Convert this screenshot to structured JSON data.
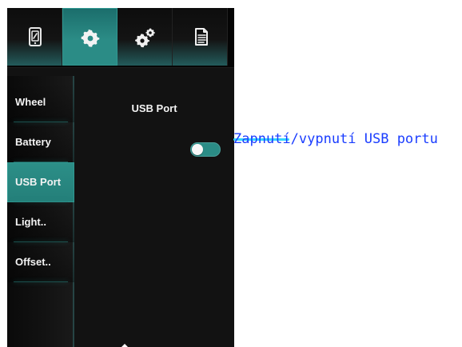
{
  "top_tabs": [
    {
      "name": "phone",
      "icon": "phone-icon",
      "active": false
    },
    {
      "name": "settings",
      "icon": "gear-icon",
      "active": true
    },
    {
      "name": "advanced",
      "icon": "gears-icon",
      "active": false
    },
    {
      "name": "log",
      "icon": "document-icon",
      "active": false
    }
  ],
  "sidebar": {
    "items": [
      {
        "label": "Wheel",
        "active": false
      },
      {
        "label": "Battery",
        "active": false
      },
      {
        "label": "USB Port",
        "active": true
      },
      {
        "label": "Light..",
        "active": false
      },
      {
        "label": "Offset..",
        "active": false
      }
    ]
  },
  "main": {
    "section_title": "USB Port",
    "usb_toggle": {
      "state": "on"
    }
  },
  "annotation": {
    "text": "Zapnutí/vypnutí USB portu"
  },
  "colors": {
    "accent": "#2b8c86",
    "annotation_text": "#1a3dff",
    "annotation_mark": "#33d6ff"
  }
}
